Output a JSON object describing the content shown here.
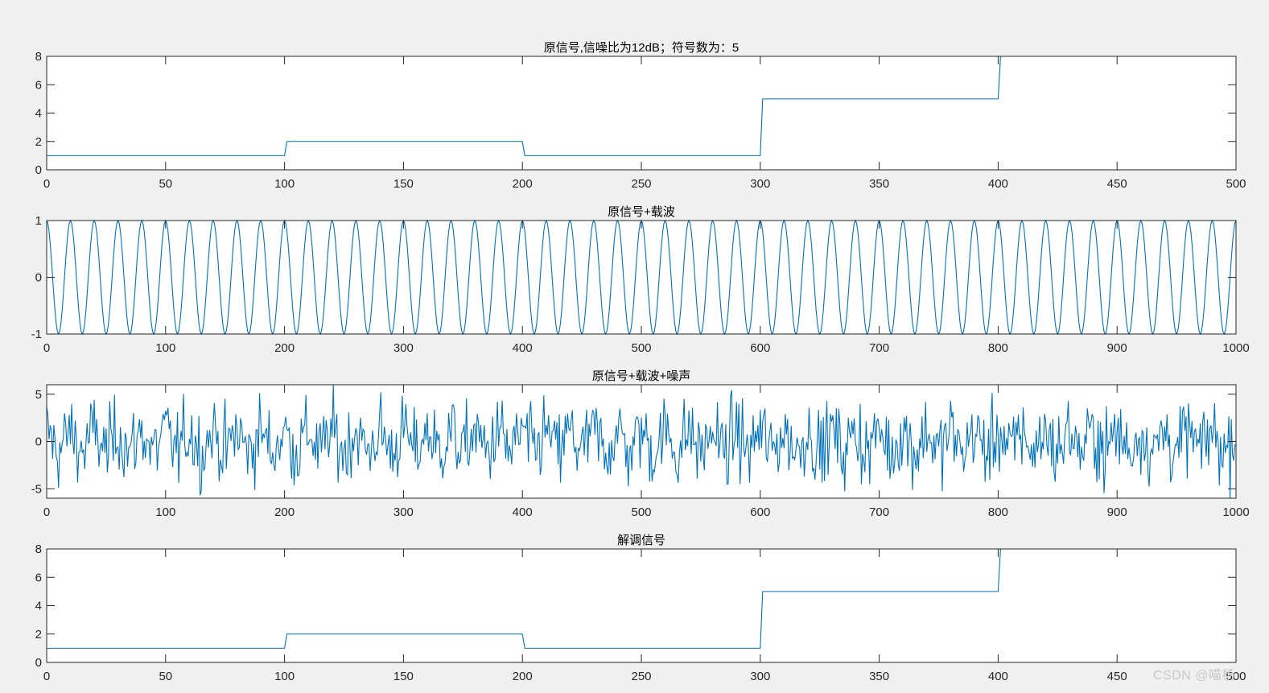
{
  "window": {
    "watermark": "CSDN @喵杨"
  },
  "style": {
    "line_color": "#0072bd",
    "axes_color": "#262626",
    "figure_bg": "#f0f0f0",
    "axes_bg": "#ffffff"
  },
  "chart_data": [
    {
      "type": "line",
      "title": "原信号,信噪比为12dB；符号数为：5",
      "xlabel": "",
      "ylabel": "",
      "xlim": [
        0,
        500
      ],
      "ylim": [
        0,
        8
      ],
      "xticks": [
        0,
        50,
        100,
        150,
        200,
        250,
        300,
        350,
        400,
        450,
        500
      ],
      "yticks": [
        0,
        2,
        4,
        6,
        8
      ],
      "grid": false,
      "series": [
        {
          "x": [
            0,
            1,
            100,
            101,
            200,
            201,
            300,
            301,
            400,
            401,
            500
          ],
          "y": [
            1,
            1,
            1,
            2,
            2,
            1,
            1,
            5,
            5,
            8,
            8
          ]
        }
      ]
    },
    {
      "type": "line",
      "title": "原信号+载波",
      "xlabel": "",
      "ylabel": "",
      "xlim": [
        0,
        1000
      ],
      "ylim": [
        -1,
        1
      ],
      "xticks": [
        0,
        100,
        200,
        300,
        400,
        500,
        600,
        700,
        800,
        900,
        1000
      ],
      "yticks": [
        -1,
        0,
        1
      ],
      "grid": false,
      "signal": {
        "form": "cos",
        "amplitude": 1,
        "period": 20,
        "segment_edges": [
          0,
          200,
          400,
          600,
          800,
          1000
        ]
      }
    },
    {
      "type": "line",
      "title": "原信号+载波+噪声",
      "xlabel": "",
      "ylabel": "",
      "xlim": [
        0,
        1000
      ],
      "ylim": [
        -6,
        6
      ],
      "xticks": [
        0,
        100,
        200,
        300,
        400,
        500,
        600,
        700,
        800,
        900,
        1000
      ],
      "yticks": [
        -5,
        0,
        5
      ],
      "grid": false,
      "signal": {
        "form": "cos + noise",
        "amplitude": 1,
        "period": 20,
        "noise_std": 2,
        "segment_edges": [
          0,
          200,
          400,
          600,
          800,
          1000
        ]
      }
    },
    {
      "type": "line",
      "title": "解调信号",
      "xlabel": "",
      "ylabel": "",
      "xlim": [
        0,
        500
      ],
      "ylim": [
        0,
        8
      ],
      "xticks": [
        0,
        50,
        100,
        150,
        200,
        250,
        300,
        350,
        400,
        450,
        500
      ],
      "yticks": [
        0,
        2,
        4,
        6,
        8
      ],
      "grid": false,
      "series": [
        {
          "x": [
            0,
            1,
            100,
            101,
            200,
            201,
            300,
            301,
            400,
            401,
            500
          ],
          "y": [
            1,
            1,
            1,
            2,
            2,
            1,
            1,
            5,
            5,
            8,
            8
          ]
        }
      ]
    }
  ]
}
